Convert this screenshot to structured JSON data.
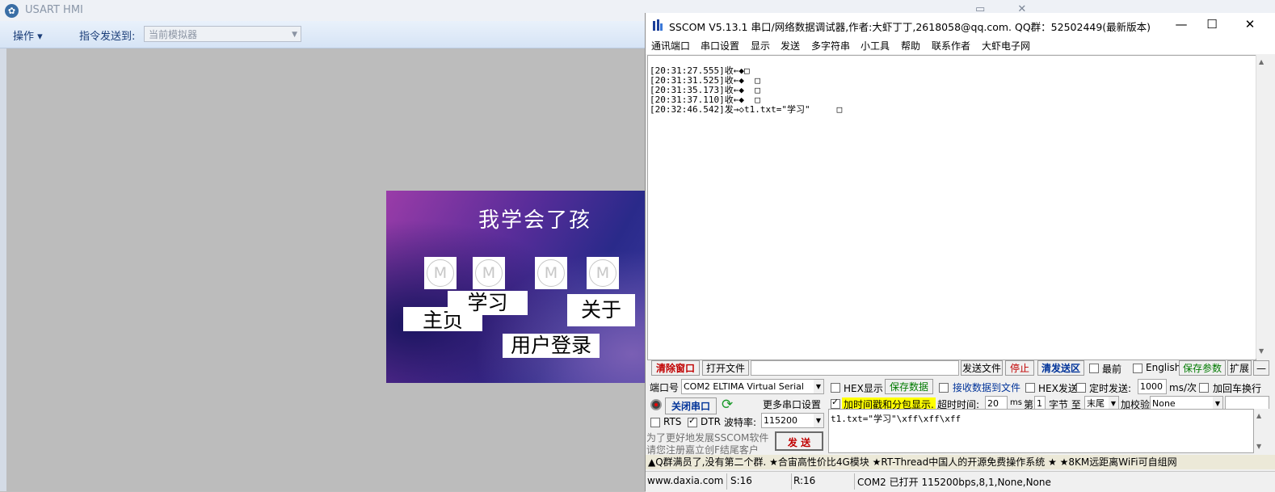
{
  "hmi": {
    "title": "USART HMI",
    "window_controls": "▭ ✕",
    "menu_ops": "操作 ▾",
    "send_to_label": "指令发送到:",
    "target_select": "当前模拟器"
  },
  "sim": {
    "title": "我学会了孩",
    "icon_glyph": "M",
    "btn_study": "学习",
    "btn_about": "关于",
    "btn_home": "主页",
    "btn_login": "用户登录"
  },
  "sscom": {
    "title": "SSCOM V5.13.1 串口/网络数据调试器,作者:大虾丁丁,2618058@qq.com. QQ群：52502449(最新版本)",
    "menu": [
      "通讯端口",
      "串口设置",
      "显示",
      "发送",
      "多字符串",
      "小工具",
      "帮助",
      "联系作者",
      "大虾电子网"
    ],
    "rx_lines": [
      "[20:31:27.555]收←◆□",
      "[20:31:31.525]收←◆  □",
      "[20:31:35.173]收←◆  □",
      "[20:31:37.110]收←◆  □",
      "[20:32:46.542]发→◇t1.txt=\"学习\"     □"
    ],
    "row1": {
      "clear": "清除窗口",
      "open_file": "打开文件",
      "send_file": "发送文件",
      "stop": "停止",
      "clear_send": "清发送区",
      "topmost": "最前",
      "english": "English",
      "save_params": "保存参数",
      "expand": "扩展",
      "dash": "—"
    },
    "row2": {
      "port_label": "端口号",
      "port_value": "COM2 ELTIMA Virtual Serial",
      "hex_display": "HEX显示",
      "save_data": "保存数据",
      "recv_to_file": "接收数据到文件",
      "hex_send": "HEX发送",
      "timed_send": "定时发送:",
      "interval": "1000",
      "interval_unit": "ms/次",
      "add_crlf": "加回车换行"
    },
    "row3": {
      "close_port": "关闭串口",
      "more_settings": "更多串口设置",
      "timestamp": "加时间戳和分包显示.",
      "timeout_label": "超时时间:",
      "timeout": "20",
      "timeout_unit": "ms",
      "nth": "第",
      "byte_start": "1",
      "bytes_to": "字节 至",
      "byte_end": "末尾",
      "checksum_label": "加校验",
      "checksum": "None"
    },
    "row4": {
      "rts": "RTS",
      "dtr": "DTR",
      "baud_label": "波特率:",
      "baud": "115200"
    },
    "promo": [
      "为了更好地发展SSCOM软件",
      "请您注册嘉立创F结尾客户"
    ],
    "send_btn": "发 送",
    "tx_text": "t1.txt=\"学习\"\\xff\\xff\\xff",
    "ad": "▲Q群满员了,没有第二个群. ★合宙高性价比4G模块 ★RT-Thread中国人的开源免费操作系统 ★ ★8KM远距离WiFi可自组网",
    "status": {
      "site": "www.daxia.com",
      "sent": "S:16",
      "recv": "R:16",
      "port_state": "COM2 已打开  115200bps,8,1,None,None"
    }
  },
  "colors": {
    "accent_red": "#c00000",
    "accent_green": "#007a00",
    "highlight_yellow": "#ffff00",
    "link_blue": "#003399"
  }
}
